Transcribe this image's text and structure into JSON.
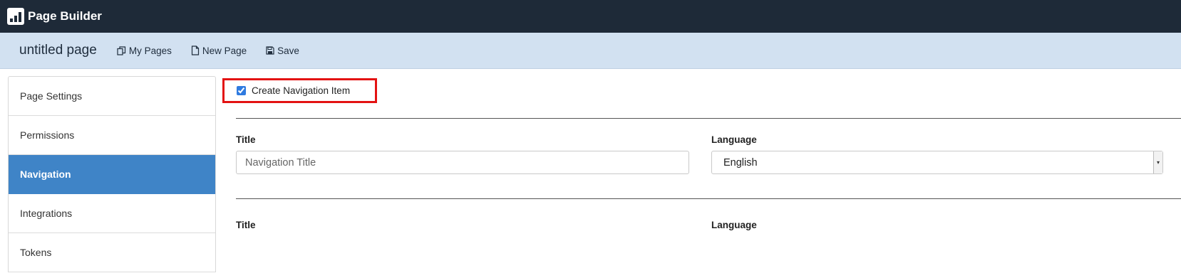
{
  "app": {
    "title": "Page Builder",
    "logo_icon": "bar-chart-icon"
  },
  "toolbar": {
    "page_name": "untitled page",
    "buttons": [
      {
        "label": "My Pages",
        "icon": "copy-icon"
      },
      {
        "label": "New Page",
        "icon": "document-icon"
      },
      {
        "label": "Save",
        "icon": "floppy-disk-icon"
      }
    ]
  },
  "sidebar": {
    "items": [
      {
        "label": "Page Settings",
        "active": false
      },
      {
        "label": "Permissions",
        "active": false
      },
      {
        "label": "Navigation",
        "active": true
      },
      {
        "label": "Integrations",
        "active": false
      },
      {
        "label": "Tokens",
        "active": false
      }
    ]
  },
  "navigation": {
    "create_item": {
      "label": "Create Navigation Item",
      "checked": true
    },
    "rows": [
      {
        "title_label": "Title",
        "title_placeholder": "Navigation Title",
        "title_value": "",
        "language_label": "Language",
        "language_value": "English"
      },
      {
        "title_label": "Title",
        "language_label": "Language"
      }
    ]
  },
  "colors": {
    "topbar": "#1e2a38",
    "toolbar": "#d2e1f1",
    "active_item": "#3f84c7",
    "highlight_border": "#e31212"
  }
}
